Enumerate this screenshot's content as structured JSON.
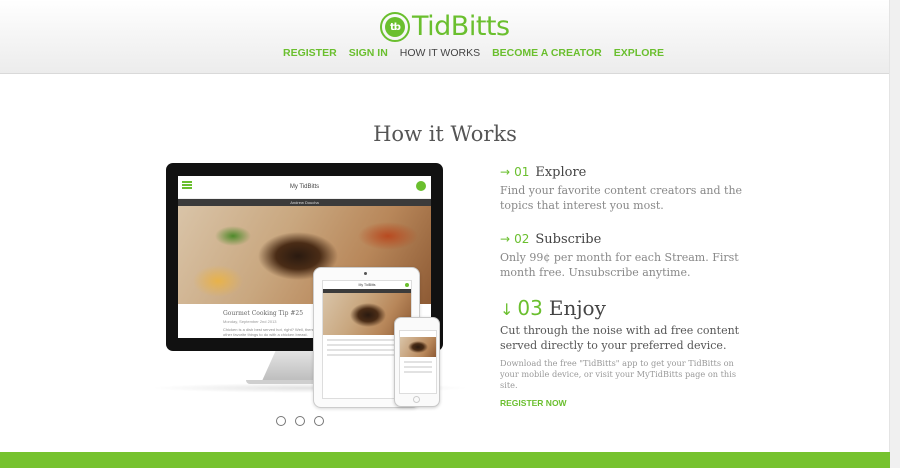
{
  "brand": {
    "name": "TidBitts",
    "badge": "tb",
    "color": "#6abf2e"
  },
  "nav": [
    {
      "label": "REGISTER",
      "active": false
    },
    {
      "label": "SIGN IN",
      "active": false
    },
    {
      "label": "HOW IT WORKS",
      "active": true
    },
    {
      "label": "BECOME A CREATOR",
      "active": false
    },
    {
      "label": "EXPLORE",
      "active": false
    }
  ],
  "page_title": "How it Works",
  "devices": {
    "app_title": "My TidBitts",
    "author": "Andrew Doucha",
    "post_title": "Gourmet Cooking Tip #25",
    "post_date": "Monday, September 2nd 2013",
    "post_text": "Chicken is a dish best served hot, right? Well, there are other favorite things to do with a chicken breast."
  },
  "steps": [
    {
      "arrow": "→",
      "number": "01",
      "title": "Explore",
      "description": "Find your favorite content creators and the topics that interest you most."
    },
    {
      "arrow": "→",
      "number": "02",
      "title": "Subscribe",
      "description": "Only 99¢ per month for each Stream. First month free. Unsubscribe anytime."
    },
    {
      "arrow": "↓",
      "number": "03",
      "title": "Enjoy",
      "description": "Cut through the noise with ad free content served directly to your preferred device.",
      "note": "Download the free \"TidBitts\" app to get your TidBitts on your mobile device, or visit your MyTidBitts page on this site.",
      "cta": "REGISTER NOW"
    }
  ],
  "carousel": {
    "count": 3
  },
  "colors": {
    "accent": "#6abf2e",
    "footer": "#76c22e"
  }
}
